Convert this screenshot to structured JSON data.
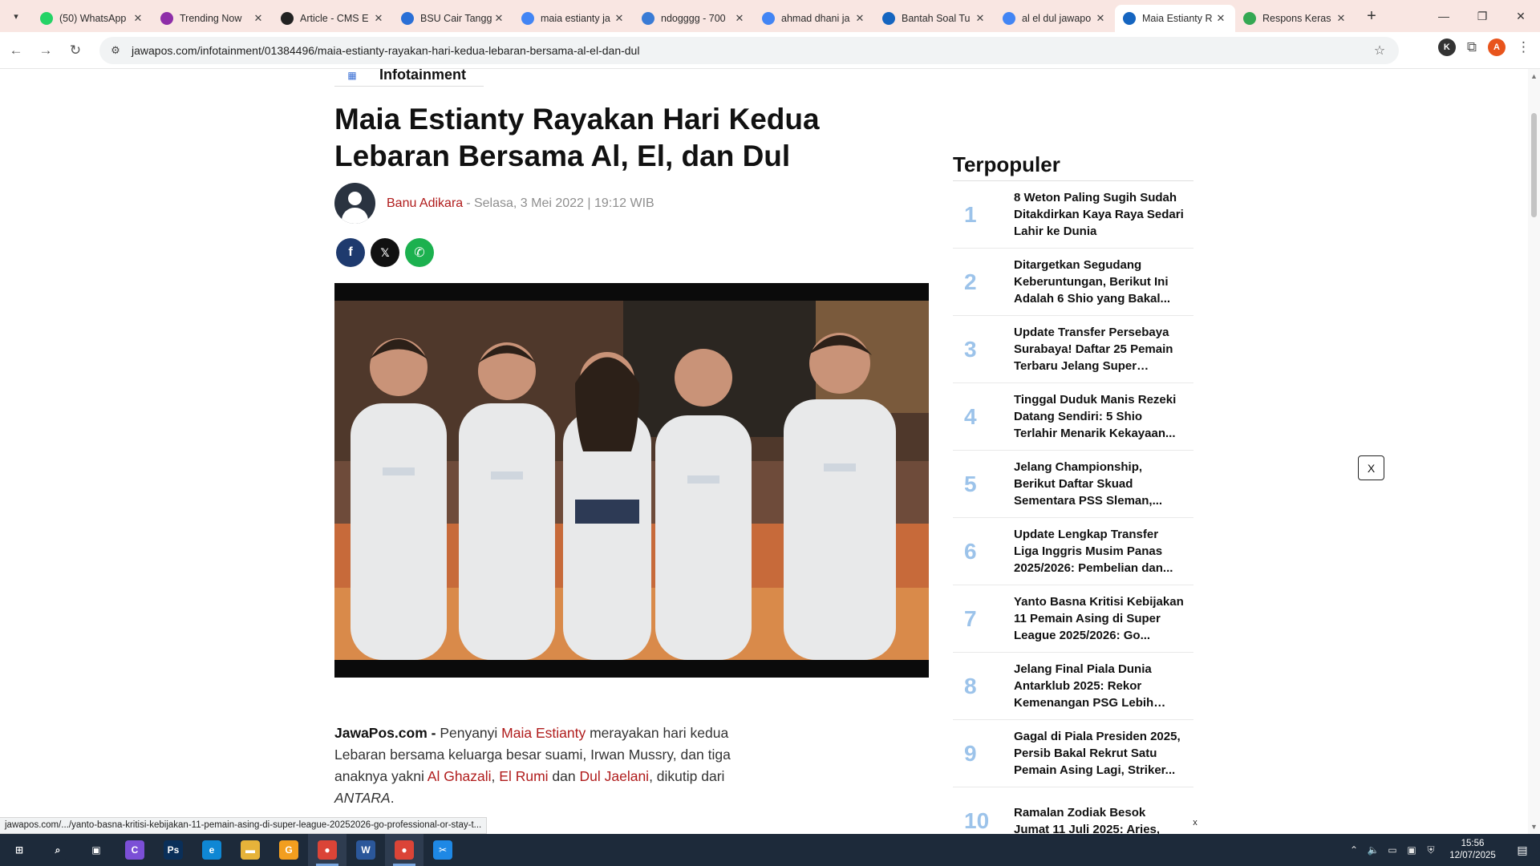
{
  "browser": {
    "tabs": [
      {
        "title": "(50) WhatsApp",
        "icon": "whatsapp-icon",
        "color": "#25d366"
      },
      {
        "title": "Trending Now",
        "icon": "trending-icon",
        "color": "#8e2ea8"
      },
      {
        "title": "Article - CMS E",
        "icon": "cms-icon",
        "color": "#222222"
      },
      {
        "title": "BSU Cair Tangg",
        "icon": "document-icon",
        "color": "#2a6fd6"
      },
      {
        "title": "maia estianty ja",
        "icon": "google-icon",
        "color": "#4285f4"
      },
      {
        "title": "ndogggg - 700",
        "icon": "ndog-icon",
        "color": "#3a7bd5"
      },
      {
        "title": "ahmad dhani ja",
        "icon": "google-icon",
        "color": "#4285f4"
      },
      {
        "title": "Bantah Soal Tu",
        "icon": "jawapos-icon",
        "color": "#1565c0"
      },
      {
        "title": "al el dul jawapo",
        "icon": "google-icon",
        "color": "#4285f4"
      },
      {
        "title": "Maia Estianty R",
        "icon": "jawapos-icon",
        "color": "#1565c0",
        "active": true
      },
      {
        "title": "Respons Keras",
        "icon": "chrome-icon",
        "color": "#34a853"
      }
    ],
    "url": "jawapos.com/infotainment/01384496/maia-estianty-rayakan-hari-kedua-lebaran-bersama-al-el-dan-dul",
    "profile_initial": "A",
    "ext_initial": "K"
  },
  "article": {
    "category": "Infotainment",
    "headline": "Maia Estianty Rayakan Hari Kedua Lebaran Bersama Al, El, dan Dul",
    "author": "Banu Adikara",
    "date": " - Selasa, 3 Mei 2022 | 19:12 WIB",
    "body": {
      "source": "JawaPos.com - ",
      "t1": "Penyanyi ",
      "maia": "Maia Estianty",
      "t2": " merayakan hari kedua Lebaran bersama keluarga besar suami, Irwan Mussry, dan tiga anaknya yakni ",
      "al": "Al Ghazali",
      "c1": ", ",
      "el": "El Rumi",
      "t3": " dan ",
      "dul": "Dul Jaelani",
      "t4": ", dikutip dari ",
      "antara": "ANTARA",
      "t5": "."
    }
  },
  "sidebar": {
    "title": "Terpopuler",
    "items": [
      {
        "num": "1",
        "text": "8 Weton Paling Sugih Sudah Ditakdirkan Kaya Raya Sedari Lahir ke Dunia"
      },
      {
        "num": "2",
        "text": "Ditargetkan Segudang Keberuntungan, Berikut Ini Adalah 6 Shio yang Bakal..."
      },
      {
        "num": "3",
        "text": "Update Transfer Persebaya Surabaya! Daftar 25 Pemain Terbaru Jelang Super Leagu..."
      },
      {
        "num": "4",
        "text": "Tinggal Duduk Manis Rezeki Datang Sendiri: 5 Shio Terlahir Menarik Kekayaan..."
      },
      {
        "num": "5",
        "text": "Jelang Championship, Berikut Daftar Skuad Sementara PSS Sleman,..."
      },
      {
        "num": "6",
        "text": "Update Lengkap Transfer Liga Inggris Musim Panas 2025/2026: Pembelian dan..."
      },
      {
        "num": "7",
        "text": "Yanto Basna Kritisi Kebijakan 11 Pemain Asing di Super League 2025/2026: Go..."
      },
      {
        "num": "8",
        "text": "Jelang Final Piala Dunia Antarklub 2025: Rekor Kemenangan PSG Lebih Bai..."
      },
      {
        "num": "9",
        "text": "Gagal di Piala Presiden 2025, Persib Bakal Rekrut Satu Pemain Asing Lagi, Striker..."
      },
      {
        "num": "10",
        "text": "Ramalan Zodiak Besok Jumat 11 Juli 2025: Aries,"
      }
    ]
  },
  "ads": {
    "close_label": "X",
    "close_small_label": "x"
  },
  "status_url": "jawapos.com/.../yanto-basna-kritisi-kebijakan-11-pemain-asing-di-super-league-20252026-go-professional-or-stay-t...",
  "taskbar": {
    "time": "15:56",
    "date": "12/07/2025",
    "apps": [
      {
        "name": "start-button",
        "label": "⊞",
        "color": "#1d2a3a"
      },
      {
        "name": "search-taskbar",
        "label": "⌕",
        "color": "#1d2a3a"
      },
      {
        "name": "task-view",
        "label": "▣",
        "color": "#1d2a3a"
      },
      {
        "name": "copilot-app",
        "label": "C",
        "color": "#7b4fd6"
      },
      {
        "name": "photoshop-app",
        "label": "Ps",
        "color": "#0a2f59"
      },
      {
        "name": "edge-app",
        "label": "e",
        "color": "#0f87d4"
      },
      {
        "name": "file-explorer-app",
        "label": "▬",
        "color": "#e6b33a"
      },
      {
        "name": "slides-app",
        "label": "G",
        "color": "#f29e1f"
      },
      {
        "name": "chrome-app",
        "label": "●",
        "color": "#db4437",
        "active": true
      },
      {
        "name": "word-app",
        "label": "W",
        "color": "#2b579a"
      },
      {
        "name": "chrome-app-2",
        "label": "●",
        "color": "#db4437",
        "active": true
      },
      {
        "name": "snipping-app",
        "label": "✂",
        "color": "#1e88e5"
      }
    ]
  }
}
